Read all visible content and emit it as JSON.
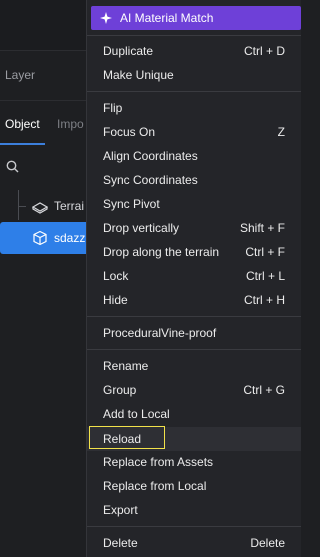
{
  "panel": {
    "layer_label": "Layer",
    "tabs": [
      {
        "label": "Object"
      },
      {
        "label": "Impo"
      }
    ],
    "search_icon": "search-icon",
    "tree": [
      {
        "label": "Terrai",
        "icon": "terrain-icon"
      },
      {
        "label": "sdazz",
        "icon": "cube-icon"
      }
    ]
  },
  "menu": {
    "ai_button": {
      "label": "AI Material Match",
      "icon": "sparkle-icon",
      "color": "#6e40d8"
    },
    "groups": [
      [
        {
          "label": "Duplicate",
          "shortcut": "Ctrl + D"
        },
        {
          "label": "Make Unique",
          "shortcut": ""
        }
      ],
      [
        {
          "label": "Flip",
          "shortcut": ""
        },
        {
          "label": "Focus On",
          "shortcut": "Z"
        },
        {
          "label": "Align Coordinates",
          "shortcut": ""
        },
        {
          "label": "Sync Coordinates",
          "shortcut": ""
        },
        {
          "label": "Sync Pivot",
          "shortcut": ""
        },
        {
          "label": "Drop vertically",
          "shortcut": "Shift + F"
        },
        {
          "label": "Drop along the terrain",
          "shortcut": "Ctrl + F"
        },
        {
          "label": "Lock",
          "shortcut": "Ctrl + L"
        },
        {
          "label": "Hide",
          "shortcut": "Ctrl + H"
        }
      ],
      [
        {
          "label": "ProceduralVine-proof",
          "shortcut": ""
        }
      ],
      [
        {
          "label": "Rename",
          "shortcut": ""
        },
        {
          "label": "Group",
          "shortcut": "Ctrl + G"
        },
        {
          "label": "Add to Local",
          "shortcut": ""
        },
        {
          "label": "Reload",
          "shortcut": ""
        },
        {
          "label": "Replace from Assets",
          "shortcut": ""
        },
        {
          "label": "Replace from Local",
          "shortcut": ""
        },
        {
          "label": "Export",
          "shortcut": ""
        }
      ],
      [
        {
          "label": "Delete",
          "shortcut": "Delete"
        }
      ]
    ]
  }
}
